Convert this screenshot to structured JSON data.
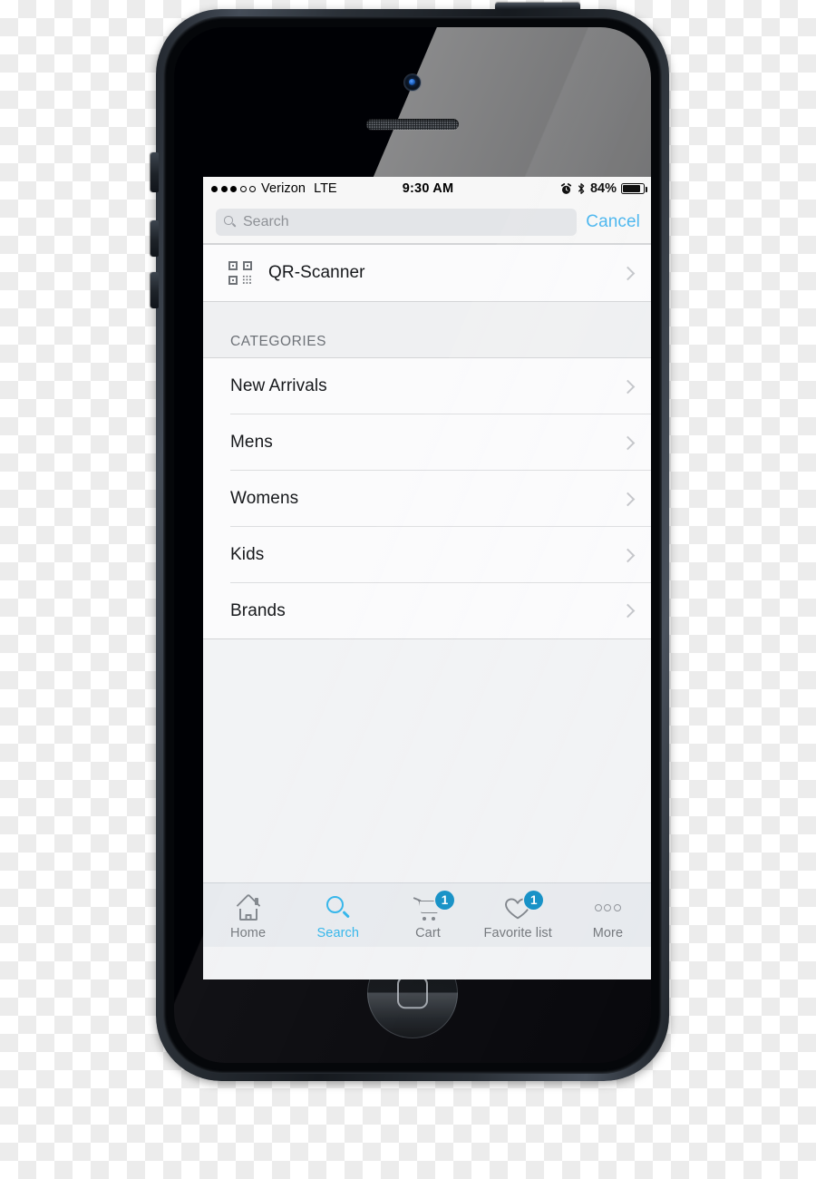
{
  "device": {
    "name": "smartphone-mockup",
    "buttons": {
      "power": "power-button",
      "silent": "silent-switch",
      "volume_up": "volume-up-button",
      "volume_down": "volume-down-button",
      "home": "home-button"
    }
  },
  "status_bar": {
    "signal_dots_filled": 3,
    "signal_dots_total": 5,
    "carrier": "Verizon",
    "network": "LTE",
    "time": "9:30 AM",
    "alarm_icon": "alarm-clock-icon",
    "bluetooth_icon": "bluetooth-icon",
    "battery_percent": "84%",
    "battery_level": 88
  },
  "search": {
    "placeholder": "Search",
    "value": "",
    "icon": "search-icon",
    "cancel_label": "Cancel"
  },
  "scanner": {
    "label": "QR-Scanner",
    "icon": "qr-code-icon"
  },
  "section": {
    "header": "CATEGORIES"
  },
  "categories": [
    {
      "label": "New Arrivals"
    },
    {
      "label": "Mens"
    },
    {
      "label": "Womens"
    },
    {
      "label": "Kids"
    },
    {
      "label": "Brands"
    }
  ],
  "tabbar": {
    "items": [
      {
        "label": "Home",
        "icon": "home-icon",
        "badge": null,
        "active": false
      },
      {
        "label": "Search",
        "icon": "search-icon",
        "badge": null,
        "active": true
      },
      {
        "label": "Cart",
        "icon": "cart-icon",
        "badge": "1",
        "active": false
      },
      {
        "label": "Favorite list",
        "icon": "heart-icon",
        "badge": "1",
        "active": false
      },
      {
        "label": "More",
        "icon": "ellipsis-icon",
        "badge": null,
        "active": false
      }
    ]
  },
  "colors": {
    "accent": "#2bb3ea",
    "cancel": "#44b4ee",
    "badge": "#0d8dc4",
    "inactive": "#7c8187",
    "screen_bg": "#f2f3f5",
    "cell_bg": "#fbfbfc",
    "tabbar_bg": "#e7eaee"
  }
}
